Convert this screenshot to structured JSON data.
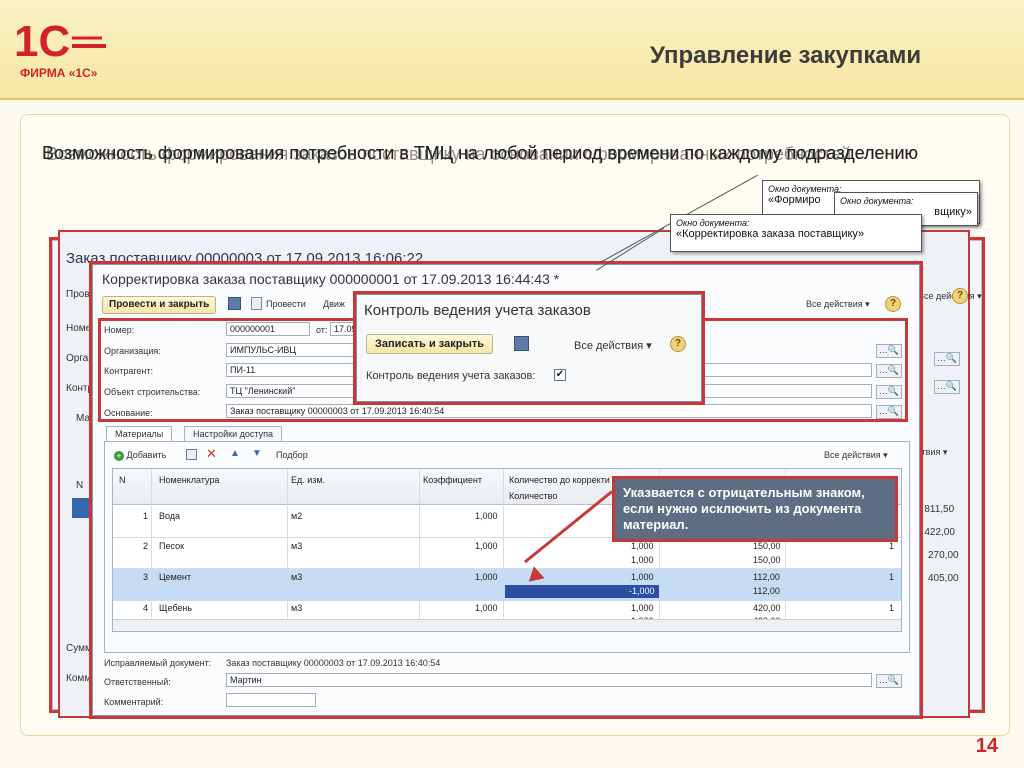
{
  "slide": {
    "logo_text": "ФИРМА «1С»",
    "title": "Управление закупками",
    "headline_1": "Возможность формирования потребности в ТМЦ на любой период времени по каждому подразделению",
    "headline_2": "Возможность формирования заказов поставщику на основании сформированных потребностей",
    "page_number": "14",
    "colors": {
      "brand_red": "#d2232a",
      "highlight_red": "#c83838"
    }
  },
  "back_window": {
    "title": "Заказ поставщику 00000003 от 17.09.2013 16:06:22",
    "fields": [
      "Пров",
      "Номер",
      "Орган",
      "Контр",
      "Мате",
      "N",
      "Сумма",
      "Комм"
    ],
    "values": [
      "3 811,50",
      "1 422,00",
      "270,00",
      "405,00"
    ],
    "actions": "Все действия ▾",
    "actions2": "йствия ▾"
  },
  "main_window": {
    "title": "Корректировка заказа поставщику 000000001 от 17.09.2013 16:44:43 *",
    "toolbar": {
      "post_close": "Провести и закрыть",
      "post": "Провести",
      "more": "Движ",
      "all_actions": "Все действия ▾",
      "help": "?"
    },
    "fields": {
      "number_label": "Номер:",
      "number": "000000001",
      "date_label": "от:",
      "date": "17.09",
      "org_label": "Организация:",
      "org": "ИМПУЛЬС-ИВЦ",
      "contractor_label": "Контрагент:",
      "contractor": "ПИ-11",
      "object_label": "Объект строительства:",
      "object": "ТЦ \"Ленинский\"",
      "basis_label": "Основание:",
      "basis": "Заказ поставщику 00000003 от 17.09.2013 16:40:54"
    },
    "tabs": [
      "Материалы",
      "Настройки доступа"
    ],
    "grid_toolbar": {
      "add": "Добавить",
      "pick": "Подбор",
      "all_actions": "Все действия ▾"
    },
    "columns": [
      "N",
      "Номенклатура",
      "Ед. изм.",
      "Коэффициент",
      "Количество до корректи",
      "Количество"
    ],
    "rows": [
      {
        "n": "1",
        "item": "Вода",
        "unit": "м2",
        "coef": "1,000",
        "qty_before": "",
        "qty": "",
        "price_a": "",
        "price_b": ""
      },
      {
        "n": "2",
        "item": "Песок",
        "unit": "м3",
        "coef": "1,000",
        "qty_before": "1,000",
        "qty": "1,000",
        "price_a": "150,00",
        "price_b": "150,00"
      },
      {
        "n": "3",
        "item": "Цемент",
        "unit": "м3",
        "coef": "1,000",
        "qty_before": "1,000",
        "qty": "-1,000",
        "price_a": "112,00",
        "price_b": "112,00"
      },
      {
        "n": "4",
        "item": "Щебень",
        "unit": "м3",
        "coef": "1,000",
        "qty_before": "1,000",
        "qty": "1,000",
        "price_a": "420,00",
        "price_b": "420,00"
      }
    ],
    "row2_tail": [
      "1",
      "1",
      "1"
    ],
    "corrected_doc_label": "Исправляемый документ:",
    "corrected_doc": "Заказ поставщику 00000003 от 17.09.2013 16:40:54",
    "responsible_label": "Ответственный:",
    "responsible": "Мартин",
    "comment_label": "Комментарий:"
  },
  "control_dialog": {
    "title": "Контроль ведения учета заказов",
    "save_close": "Записать и закрыть",
    "all_actions": "Все действия ▾",
    "checkbox_label": "Контроль ведения учета заказов:",
    "checked": "✔"
  },
  "notes": {
    "note1_title": "Окно документа:",
    "note1_value": "«Формиро",
    "note2_title": "Окно документа:",
    "note2_value": "вщику»",
    "note3_title": "Окно документа:",
    "note3_value": "«Корректировка заказа поставщику»",
    "callout": "Указвается с отрицательным знаком, если нужно исключить из документа материал."
  }
}
